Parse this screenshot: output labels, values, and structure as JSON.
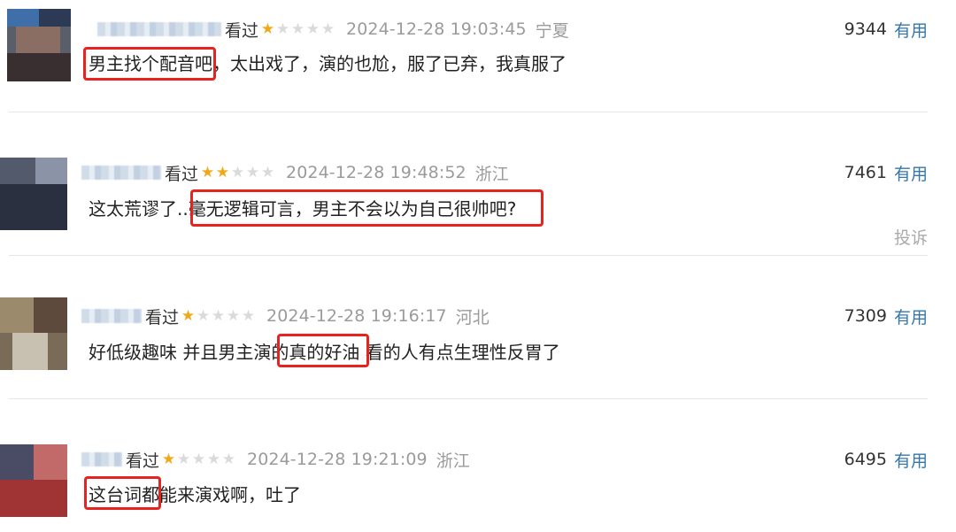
{
  "comments": [
    {
      "watched": "看过",
      "rating": 1,
      "time": "2024-12-28 19:03:45",
      "location": "宁夏",
      "votes": "9344",
      "useful": "有用",
      "text_hl": "男主找个配音吧",
      "text_rest": "，太出戏了，演的也尬，服了已弃，我真服了"
    },
    {
      "watched": "看过",
      "rating": 2,
      "time": "2024-12-28 19:48:52",
      "location": "浙江",
      "votes": "7461",
      "useful": "有用",
      "text_pre": "这太荒谬了..",
      "text_hl": "毫无逻辑可言，男主不会以为自己很帅吧?",
      "report": "投诉"
    },
    {
      "watched": "看过",
      "rating": 1,
      "time": "2024-12-28 19:16:17",
      "location": "河北",
      "votes": "7309",
      "useful": "有用",
      "text": "好低级趣味 并且男主演的真的好油 看的人有点生理性反胃了"
    },
    {
      "watched": "看过",
      "rating": 1,
      "time": "2024-12-28 19:21:09",
      "location": "浙江",
      "votes": "6495",
      "useful": "有用",
      "text_hl": "这台词都",
      "text_rest": "能来演戏啊，吐了"
    }
  ],
  "star_icon": "star-icon",
  "colors": {
    "highlight": "#e8231f",
    "star_on": "#f0a81a",
    "star_off": "#dadada",
    "link": "#3677a9",
    "meta_gray": "#9b9b9b"
  }
}
